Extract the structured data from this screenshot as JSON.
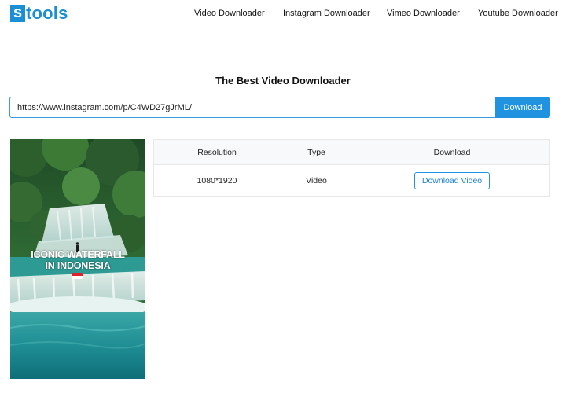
{
  "header": {
    "logo_mark": "s",
    "logo_text": "tools",
    "nav": [
      {
        "label": "Video Downloader"
      },
      {
        "label": "Instagram Downloader"
      },
      {
        "label": "Vimeo Downloader"
      },
      {
        "label": "Youtube Downloader"
      }
    ]
  },
  "main": {
    "title": "The Best Video Downloader",
    "search": {
      "value": "https://www.instagram.com/p/C4WD27gJrML/",
      "placeholder": ""
    },
    "download_button": "Download",
    "thumbnail": {
      "caption_line1": "ICONIC WATERFALL",
      "caption_line2": "IN INDONESIA"
    },
    "table": {
      "headers": [
        "Resolution",
        "Type",
        "Download"
      ],
      "rows": [
        {
          "resolution": "1080*1920",
          "type": "Video",
          "action": "Download Video"
        }
      ]
    }
  },
  "colors": {
    "brand": "#1a8fd6",
    "button": "#1f93e0",
    "input_border": "#3a9be0"
  }
}
